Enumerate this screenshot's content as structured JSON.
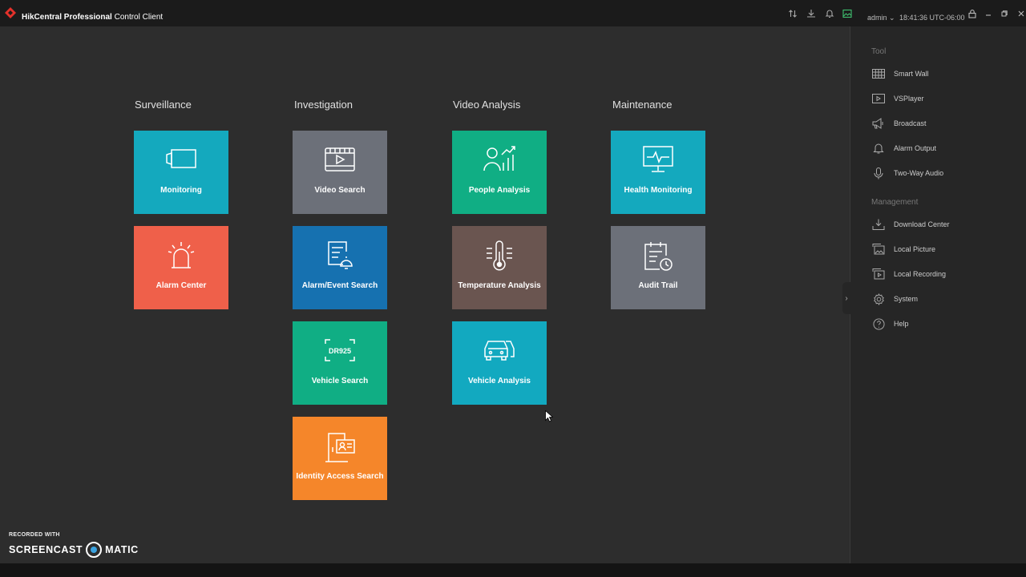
{
  "titlebar": {
    "brand": "HikCentral Professional",
    "product": "Control Client",
    "user": "admin",
    "time": "18:41:36 UTC-06:00",
    "icons": [
      "sort-icon",
      "download-icon",
      "bell-icon",
      "image-icon",
      "lock-icon",
      "minimize-icon",
      "restore-icon",
      "close-icon"
    ]
  },
  "groups": [
    {
      "title": "Surveillance"
    },
    {
      "title": "Investigation"
    },
    {
      "title": "Video Analysis"
    },
    {
      "title": "Maintenance"
    }
  ],
  "tiles": {
    "monitoring": {
      "label": "Monitoring",
      "color": "#14a9be"
    },
    "alarm_center": {
      "label": "Alarm Center",
      "color": "#ef604a"
    },
    "video_search": {
      "label": "Video Search",
      "color": "#6c7079"
    },
    "alarm_event_search": {
      "label": "Alarm/Event Search",
      "color": "#1671b0"
    },
    "vehicle_search": {
      "label": "Vehicle Search",
      "color": "#10ae84",
      "plate": "DR925"
    },
    "identity_access_search": {
      "label": "Identity Access Search",
      "color": "#f5862a"
    },
    "people_analysis": {
      "label": "People Analysis",
      "color": "#10ae84"
    },
    "temperature_analysis": {
      "label": "Temperature Analysis",
      "color": "#6a5550"
    },
    "vehicle_analysis": {
      "label": "Vehicle Analysis",
      "color": "#12a9c0"
    },
    "health_monitoring": {
      "label": "Health Monitoring",
      "color": "#14a9be"
    },
    "audit_trail": {
      "label": "Audit Trail",
      "color": "#6c7079"
    }
  },
  "panel": {
    "tool_title": "Tool",
    "tool_items": [
      {
        "label": "Smart Wall",
        "icon": "smart-wall-icon"
      },
      {
        "label": "VSPlayer",
        "icon": "player-icon"
      },
      {
        "label": "Broadcast",
        "icon": "broadcast-icon"
      },
      {
        "label": "Alarm Output",
        "icon": "alarm-bell-icon"
      },
      {
        "label": "Two-Way Audio",
        "icon": "microphone-icon"
      }
    ],
    "management_title": "Management",
    "management_items": [
      {
        "label": "Download Center",
        "icon": "download-center-icon"
      },
      {
        "label": "Local Picture",
        "icon": "picture-icon"
      },
      {
        "label": "Local Recording",
        "icon": "recording-icon"
      },
      {
        "label": "System",
        "icon": "gear-icon"
      },
      {
        "label": "Help",
        "icon": "help-icon"
      }
    ]
  },
  "watermark": {
    "recorded_with": "RECORDED WITH",
    "brand_left": "SCREENCAST",
    "brand_right": "MATIC"
  }
}
